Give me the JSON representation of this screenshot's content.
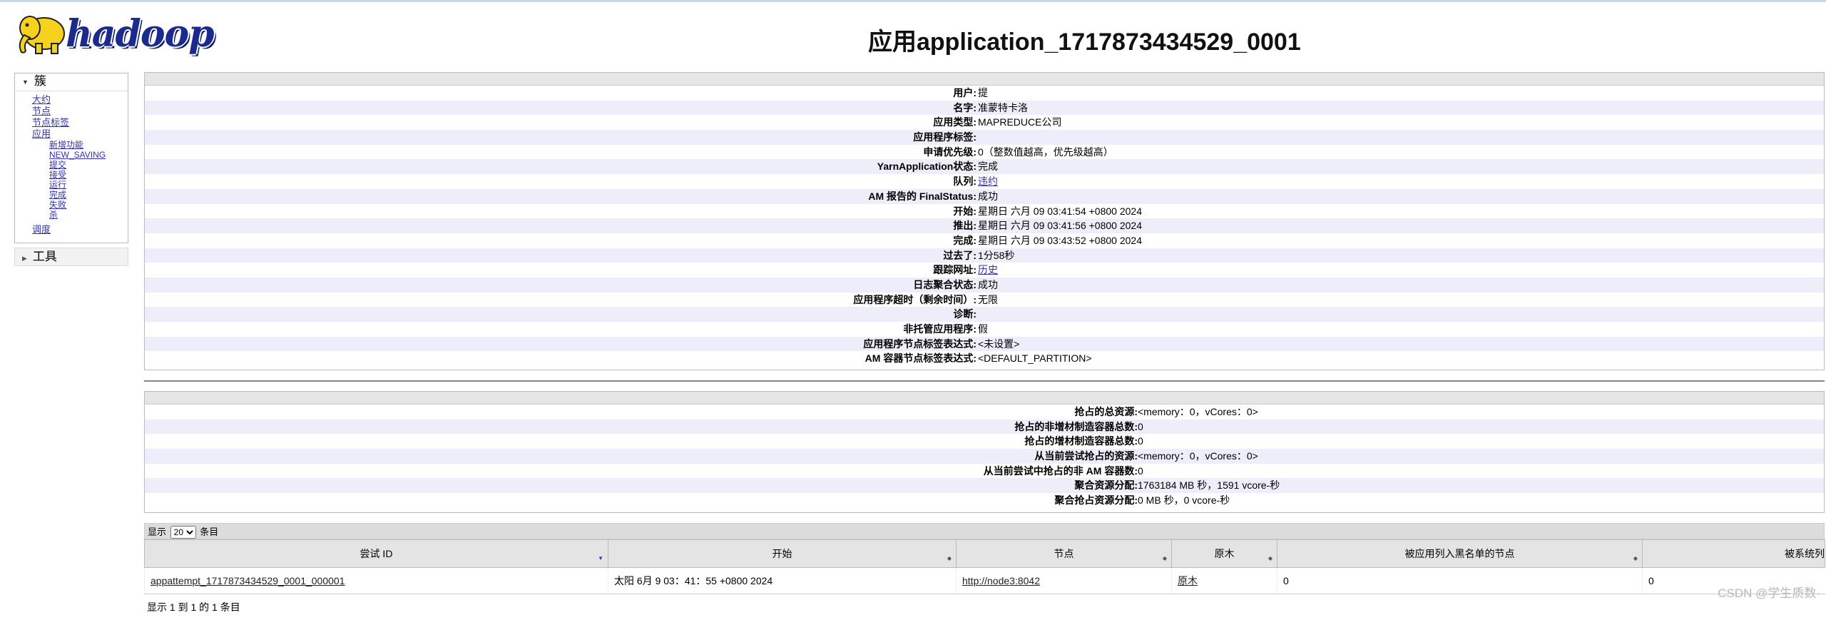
{
  "header": {
    "logo_text": "hadoop",
    "title": "应用application_1717873434529_0001"
  },
  "nav": {
    "cluster_label": "簇",
    "items": [
      "大约",
      "节点",
      "节点标签",
      "应用"
    ],
    "app_states": [
      "新增功能",
      "NEW_SAVING",
      "提交",
      "接受",
      "运行",
      "完成",
      "失败",
      "杀"
    ],
    "scheduler_label": "调度",
    "tools_label": "工具"
  },
  "overview": {
    "rows": [
      {
        "k": "用户:",
        "v": "提"
      },
      {
        "k": "名字:",
        "v": "准蒙特卡洛"
      },
      {
        "k": "应用类型:",
        "v": "MAPREDUCE公司"
      },
      {
        "k": "应用程序标签:",
        "v": ""
      },
      {
        "k": "申请优先级:",
        "v": "0（整数值越高，优先级越高）"
      },
      {
        "k": "YarnApplication状态:",
        "v": "完成"
      },
      {
        "k": "队列:",
        "v": "违约",
        "link": true
      },
      {
        "k": "AM 报告的 FinalStatus:",
        "v": "成功"
      },
      {
        "k": "开始:",
        "v": "星期日 六月 09 03:41:54 +0800 2024"
      },
      {
        "k": "推出:",
        "v": "星期日 六月 09 03:41:56 +0800 2024"
      },
      {
        "k": "完成:",
        "v": "星期日 六月 09 03:43:52 +0800 2024"
      },
      {
        "k": "过去了:",
        "v": "1分58秒"
      },
      {
        "k": "跟踪网址:",
        "v": "历史",
        "link": true
      },
      {
        "k": "日志聚合状态:",
        "v": "成功"
      },
      {
        "k": "应用程序超时（剩余时间）:",
        "v": "无限"
      },
      {
        "k": "诊断:",
        "v": ""
      },
      {
        "k": "非托管应用程序:",
        "v": "假"
      },
      {
        "k": "应用程序节点标签表达式:",
        "v": "<未设置>"
      },
      {
        "k": "AM 容器节点标签表达式:",
        "v": "<DEFAULT_PARTITION>"
      }
    ]
  },
  "metrics": {
    "rows": [
      {
        "k": "抢占的总资源:",
        "v": "<memory：0，vCores：0>"
      },
      {
        "k": "抢占的非增材制造容器总数:",
        "v": "0"
      },
      {
        "k": "抢占的增材制造容器总数:",
        "v": "0"
      },
      {
        "k": "从当前尝试抢占的资源:",
        "v": "<memory：0，vCores：0>"
      },
      {
        "k": "从当前尝试中抢占的非 AM 容器数:",
        "v": "0"
      },
      {
        "k": "聚合资源分配:",
        "v": "1763184 MB 秒，1591 vcore-秒"
      },
      {
        "k": "聚合抢占资源分配:",
        "v": "0 MB 秒，0 vcore-秒"
      }
    ]
  },
  "attempts": {
    "show_prefix": "显示",
    "show_value": "20",
    "show_suffix": "条目",
    "columns": [
      "尝试 ID",
      "开始",
      "节点",
      "原木",
      "被应用列入黑名单的节点",
      "被系统列"
    ],
    "rows": [
      {
        "id": "appattempt_1717873434529_0001_000001",
        "start": "太阳 6月 9 03：41：55 +0800 2024",
        "node": "http://node3:8042",
        "logs": "原木",
        "blacklisted": "0",
        "system": "0"
      }
    ],
    "info": "显示 1 到 1 的 1 条目"
  },
  "watermark": "CSDN @学生质数·"
}
